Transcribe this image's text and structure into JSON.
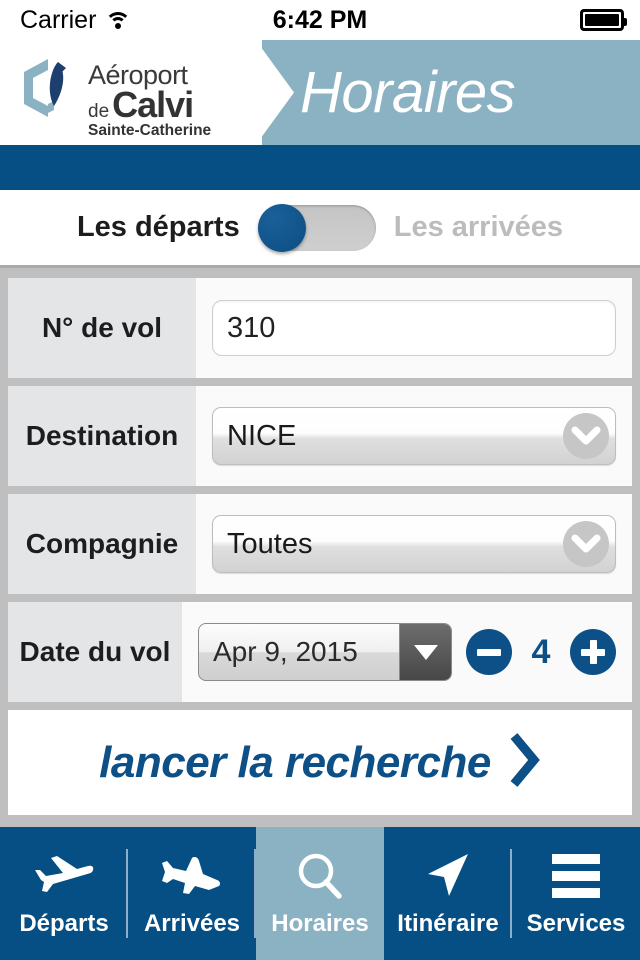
{
  "status_bar": {
    "carrier": "Carrier",
    "wifi_icon": "wifi-icon",
    "time": "6:42 PM",
    "battery_icon": "battery-full-icon"
  },
  "header": {
    "logo": {
      "line1": "Aéroport",
      "de": "de",
      "name": "Calvi",
      "subtitle": "Sainte-Catherine",
      "mark_icon": "calvi-hexagon-logo-icon"
    },
    "title": "Horaires",
    "accent_color": "#8bb2c3",
    "brand_blue": "#064f84"
  },
  "segment": {
    "departures_label": "Les départs",
    "arrivals_label": "Les arrivées",
    "selected": "departures",
    "knob_color": "#0d4f87"
  },
  "form": {
    "flight_number": {
      "label": "N° de vol",
      "value": "310",
      "placeholder": "N° de vol"
    },
    "destination": {
      "label": "Destination",
      "value": "NICE",
      "chevron_icon": "chevron-down-icon"
    },
    "airline": {
      "label": "Compagnie",
      "value": "Toutes",
      "chevron_icon": "chevron-down-icon"
    },
    "flight_date": {
      "label": "Date du vol",
      "value": "Apr 9, 2015",
      "dropdown_icon": "triangle-down-icon",
      "decrement_icon": "minus-circle-icon",
      "increment_icon": "plus-circle-icon",
      "day_count": "4"
    },
    "search_button": {
      "label": "lancer la recherche",
      "arrow_icon": "chevron-right-icon"
    }
  },
  "tabbar": {
    "active_index": 2,
    "active_color": "#8bb2c3",
    "background_color": "#064f84",
    "items": [
      {
        "label": "Départs",
        "icon": "plane-departure-icon"
      },
      {
        "label": "Arrivées",
        "icon": "plane-arrival-icon"
      },
      {
        "label": "Horaires",
        "icon": "search-magnifier-icon"
      },
      {
        "label": "Itinéraire",
        "icon": "navigation-arrow-icon"
      },
      {
        "label": "Services",
        "icon": "hamburger-menu-icon"
      }
    ]
  }
}
